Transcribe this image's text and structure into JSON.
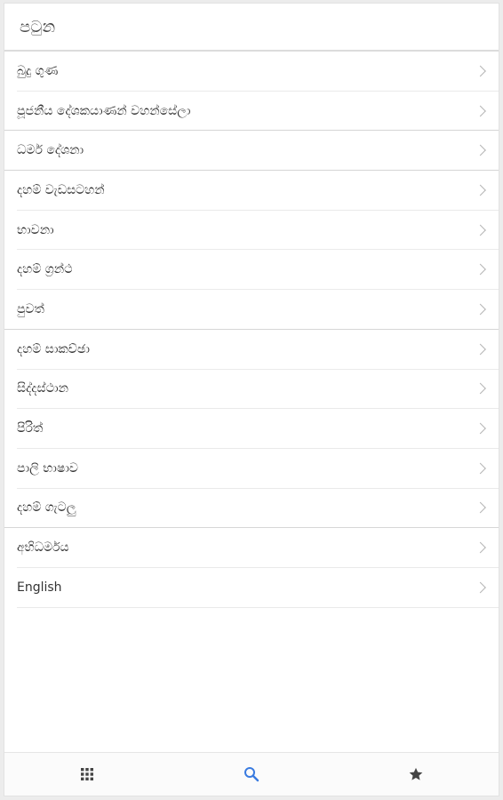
{
  "header": {
    "title": "පටුන"
  },
  "menu": {
    "items": [
      {
        "label": "බුදු ගුණ"
      },
      {
        "label": "පූජනීය දේශකයාණන් වහන්සේලා"
      },
      {
        "label": "ධර්ම දේශනා"
      },
      {
        "label": "දහම් වැඩසටහන්"
      },
      {
        "label": "භාවනා"
      },
      {
        "label": "දහම් ග්‍රන්ථ"
      },
      {
        "label": "පුවත්"
      },
      {
        "label": "දහම් සාකච්ඡා"
      },
      {
        "label": "සිද්දස්ථාන"
      },
      {
        "label": "පිරිත්"
      },
      {
        "label": "පාලි භාෂාව"
      },
      {
        "label": "දහම් ගැටලු"
      },
      {
        "label": "අභිධර්මය"
      },
      {
        "label": "English"
      }
    ]
  },
  "tabbar": {
    "tabs": [
      {
        "icon": "grid-icon",
        "active": false
      },
      {
        "icon": "search-icon",
        "active": true
      },
      {
        "icon": "star-icon",
        "active": false
      }
    ]
  },
  "colors": {
    "active_tab": "#3a7be0",
    "inactive_tab": "#444444",
    "chevron": "#b5b5b5",
    "text": "#333333"
  }
}
